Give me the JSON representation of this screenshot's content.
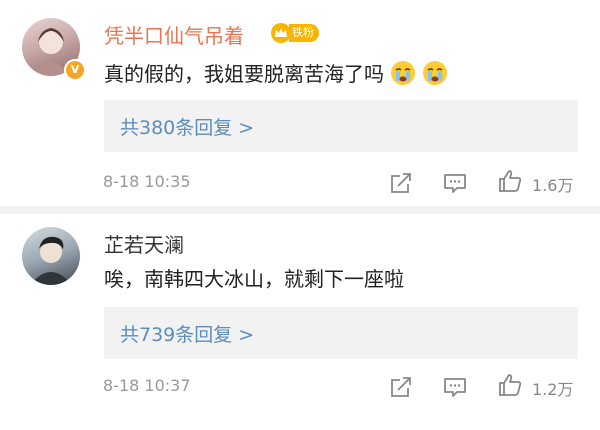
{
  "comments": [
    {
      "username": "凭半口仙气吊着",
      "fan_badge": "铁粉",
      "text": "真的假的，我姐要脱离苦海了吗",
      "emojis": [
        "crying-face-icon",
        "crying-face-icon"
      ],
      "reply_link": "共380条回复 >",
      "time": "8-18 10:35",
      "like_count": "1.6万",
      "verified": true
    },
    {
      "username": "芷若天澜",
      "text": "唉，南韩四大冰山，就剩下一座啦",
      "reply_link": "共739条回复 >",
      "time": "8-18 10:37",
      "like_count": "1.2万"
    }
  ],
  "colors": {
    "username_highlight": "#eb7350",
    "link": "#5b8dbd",
    "reply_bg": "#f2f2f2",
    "meta": "#999999",
    "badge": "#f7b500"
  }
}
